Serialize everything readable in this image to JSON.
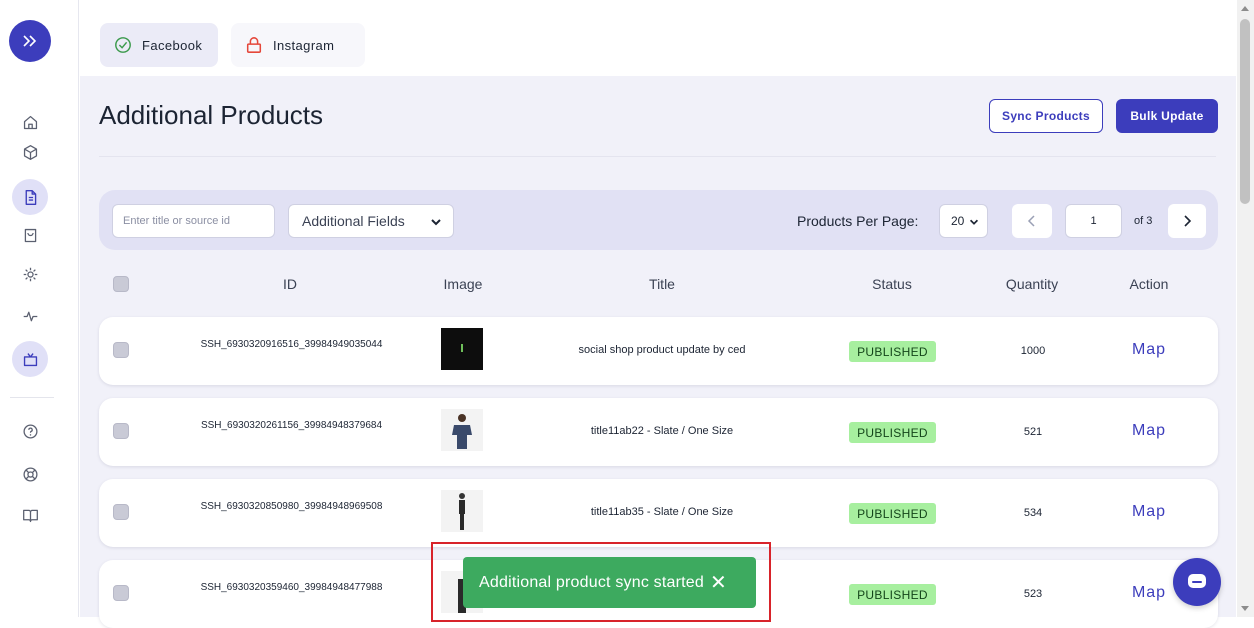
{
  "topbar": {
    "tabs": [
      {
        "label": "Facebook",
        "icon": "check-circle-icon"
      },
      {
        "label": "Instagram",
        "icon": "lock-icon"
      }
    ]
  },
  "sidebar": {
    "items": [
      {
        "name": "home-icon",
        "active": false
      },
      {
        "name": "cube-icon",
        "active": false
      },
      {
        "name": "document-icon",
        "active": true
      },
      {
        "name": "bag-icon",
        "active": false
      },
      {
        "name": "gear-icon",
        "active": false
      },
      {
        "name": "activity-icon",
        "active": false
      },
      {
        "name": "tv-icon",
        "active": true
      },
      {
        "name": "help-icon",
        "active": false
      },
      {
        "name": "lifebuoy-icon",
        "active": false
      },
      {
        "name": "book-icon",
        "active": false
      }
    ]
  },
  "page": {
    "title": "Additional Products",
    "sync_label": "Sync Products",
    "bulk_label": "Bulk Update"
  },
  "filters": {
    "search_placeholder": "Enter title or source id",
    "fields_label": "Additional Fields",
    "per_page_label": "Products Per Page:",
    "per_page_value": "20",
    "current_page": "1",
    "of_pages": "of 3"
  },
  "table": {
    "headers": [
      "ID",
      "Image",
      "Title",
      "Status",
      "Quantity",
      "Action"
    ],
    "rows": [
      {
        "id": "SSH_6930320916516_39984949035044",
        "title": "social shop product update by ced",
        "status": "PUBLISHED",
        "quantity": "1000",
        "action": "Map"
      },
      {
        "id": "SSH_6930320261156_39984948379684",
        "title": "title11ab22 - Slate / One Size",
        "status": "PUBLISHED",
        "quantity": "521",
        "action": "Map"
      },
      {
        "id": "SSH_6930320850980_39984948969508",
        "title": "title11ab35 - Slate / One Size",
        "status": "PUBLISHED",
        "quantity": "534",
        "action": "Map"
      },
      {
        "id": "SSH_6930320359460_39984948477988",
        "title": "",
        "status": "PUBLISHED",
        "quantity": "523",
        "action": "Map"
      }
    ]
  },
  "toast": {
    "message": "Additional product sync started"
  },
  "colors": {
    "accent": "#3c3dbc",
    "badge_bg": "#a7ef9f",
    "toast_bg": "#3daa5f",
    "highlight_outline": "#d8232a"
  }
}
